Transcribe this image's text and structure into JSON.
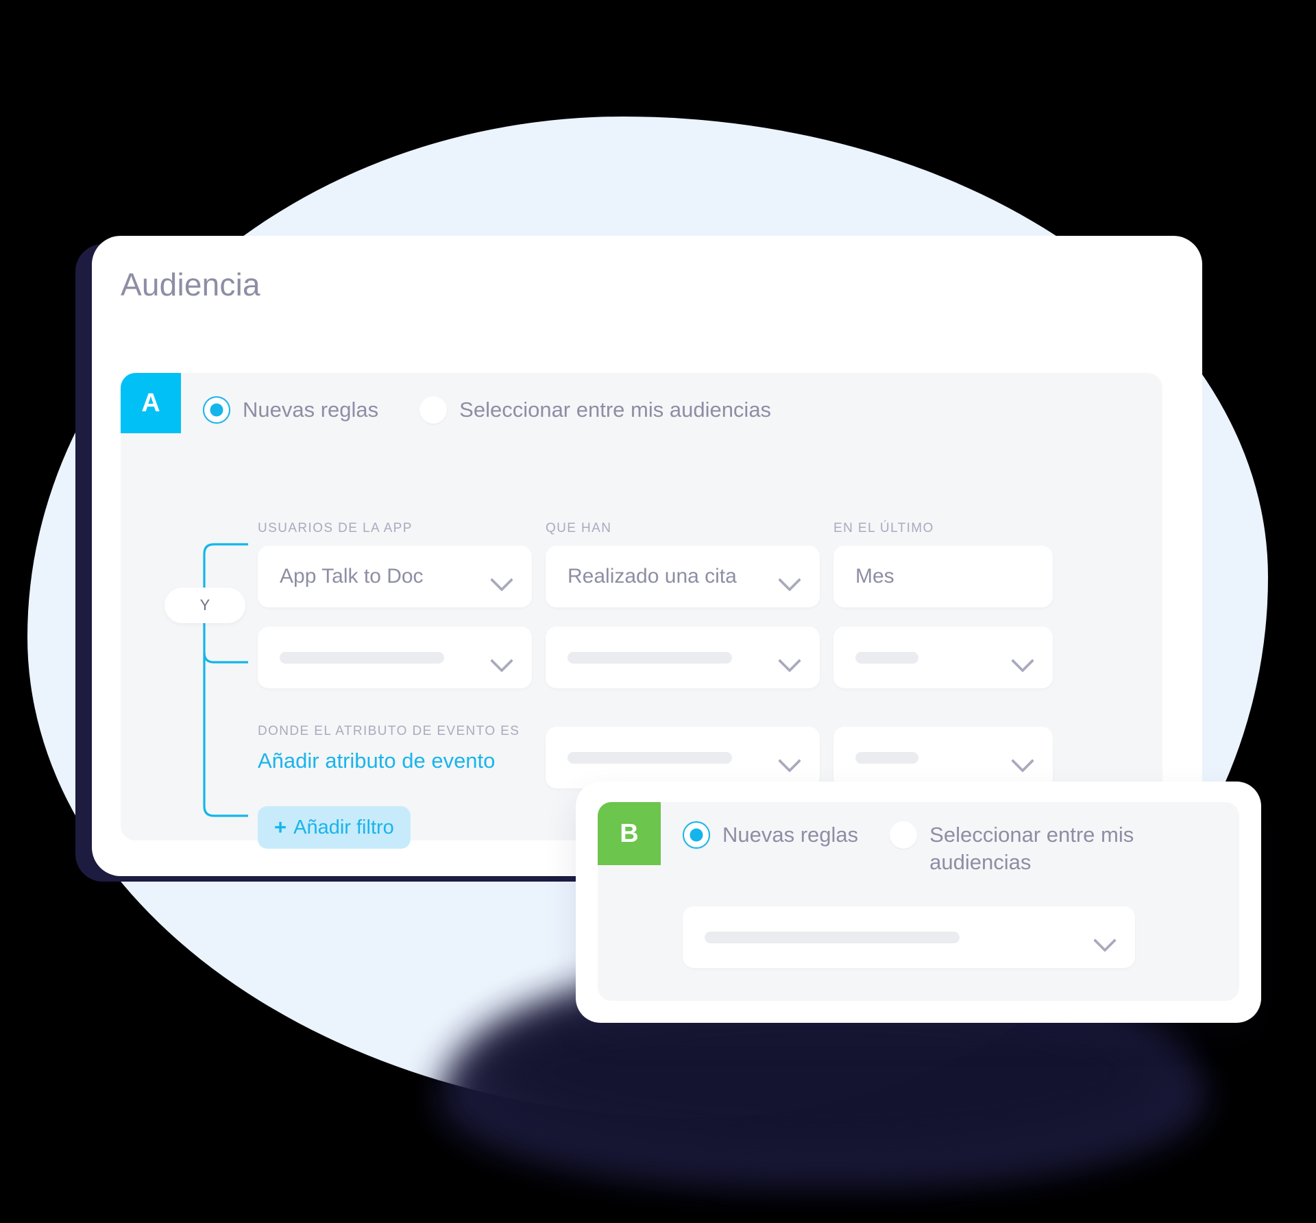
{
  "page": {
    "title": "Audiencia"
  },
  "colors": {
    "badge_a": "#00c0f6",
    "badge_b": "#6cc54c",
    "accent_cyan": "#13b5ea",
    "link": "#19b4ec",
    "filter_button_bg": "#c7ebfb",
    "panel_bg": "#f5f6f8",
    "text_muted": "#8d8ea4",
    "label_muted": "#a9aabd",
    "backdrop_blob": "#ebf3fd",
    "backdrop_shadow": "#1d1b40"
  },
  "card_a": {
    "badge": "A",
    "radio_options": [
      {
        "label": "Nuevas reglas",
        "selected": true
      },
      {
        "label": "Seleccionar entre mis audiencias",
        "selected": false
      }
    ],
    "column_labels": {
      "col1": "USUARIOS DE LA APP",
      "col2": "QUE HAN",
      "col3": "EN EL ÚLTIMO"
    },
    "fields": {
      "app": "App Talk to Doc",
      "event": "Realizado una cita",
      "period": "Mes"
    },
    "attribute_label": "DONDE EL ATRIBUTO DE EVENTO ES",
    "attribute_link": "Añadir atributo de evento",
    "add_filter_button": {
      "plus": "+",
      "label": "Añadir filtro"
    },
    "connector_operator": "Y"
  },
  "card_b": {
    "badge": "B",
    "radio_options": [
      {
        "label": "Nuevas reglas",
        "selected": true
      },
      {
        "label": "Seleccionar entre mis audiencias",
        "selected": false
      }
    ]
  }
}
